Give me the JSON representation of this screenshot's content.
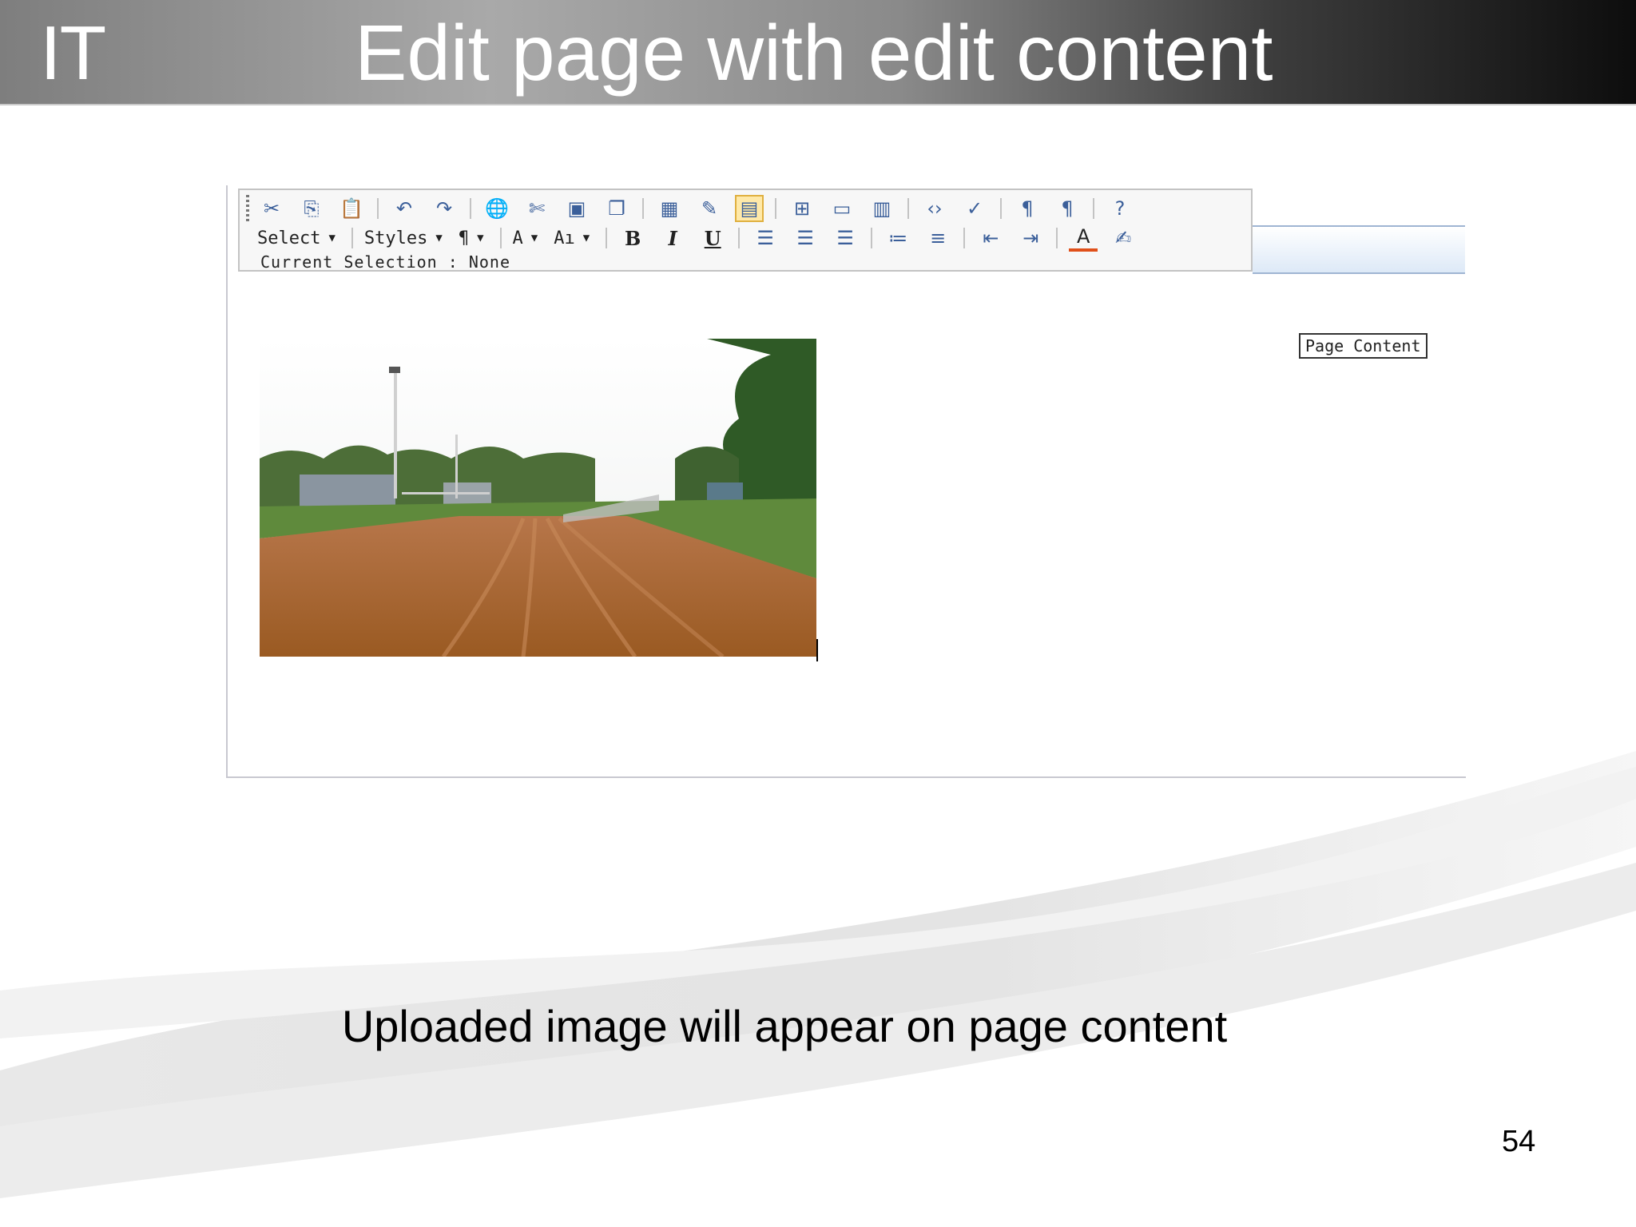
{
  "header": {
    "brand": "IT",
    "title": "Edit page with edit content"
  },
  "editor": {
    "format_dropdowns": {
      "select_label": "Select",
      "styles_label": "Styles"
    },
    "status": "Current Selection : None",
    "page_content_label": "Page Content",
    "toolbar_icons_row1": [
      "cut-icon",
      "copy-icon",
      "paste-icon",
      "undo-icon",
      "redo-icon",
      "insert-link-icon",
      "remove-link-icon",
      "insert-image-icon",
      "insert-media-icon",
      "insert-table-icon",
      "edit-table-icon",
      "table-properties-icon",
      "insert-row-icon",
      "insert-column-icon",
      "cell-properties-icon",
      "html-source-icon",
      "spellcheck-icon",
      "ltr-icon",
      "rtl-icon",
      "help-icon"
    ],
    "bold": "B",
    "italic": "I",
    "underline": "U"
  },
  "caption": "Uploaded image will appear on page content",
  "page_number": "54"
}
